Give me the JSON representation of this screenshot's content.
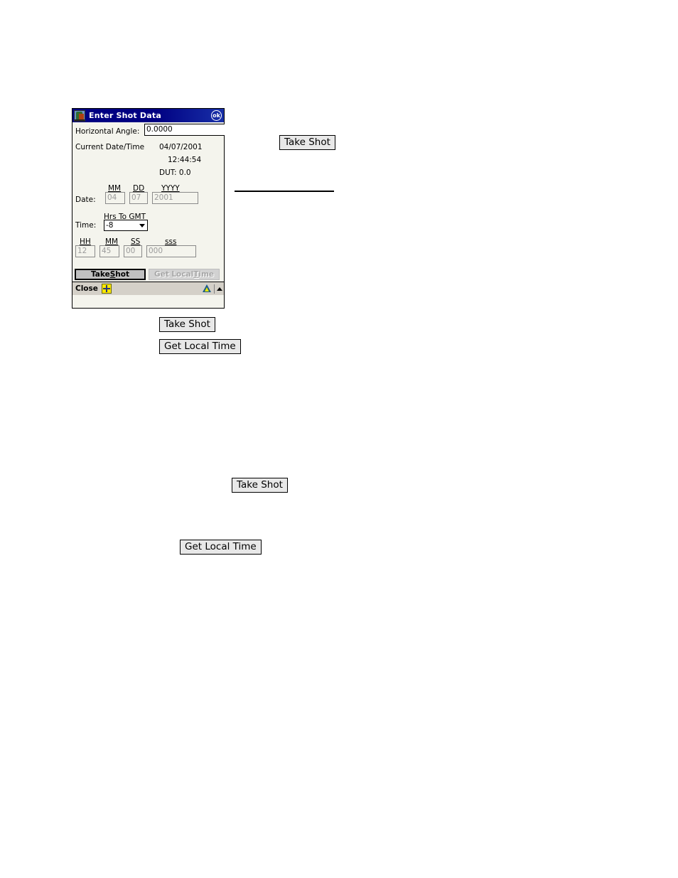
{
  "window": {
    "title": "Enter Shot Data",
    "app_icon": "app-icon",
    "ok_label": "ok"
  },
  "form": {
    "horizontal_angle": {
      "label": "Horizontal Angle:",
      "value": "0.0000"
    },
    "current": {
      "label": "Current Date/Time",
      "date": "04/07/2001",
      "time": "12:44:54",
      "dut": "DUT:   0.0"
    },
    "date_row": {
      "label": "Date:",
      "headers": {
        "mm": "MM",
        "dd": "DD",
        "yyyy": "YYYY"
      },
      "values": {
        "mm": "04",
        "dd": "07",
        "yyyy": "2001"
      }
    },
    "time_row": {
      "label": "Time:",
      "gmt_header": "Hrs To GMT",
      "gmt_value": "-8",
      "gmt_options": [
        "-8"
      ]
    },
    "clock_row": {
      "headers": {
        "hh": "HH",
        "mm": "MM",
        "ss": "SS",
        "sss": "sss"
      },
      "values": {
        "hh": "12",
        "mm": "45",
        "ss": "00",
        "sss": "000"
      }
    }
  },
  "commandbar": {
    "take_shot": "Take Shot",
    "take_shot_pre": "Take ",
    "take_shot_accel": "S",
    "take_shot_post": "hot",
    "get_local_time": "Get Local Time",
    "get_local_pre": "Get Local ",
    "get_local_accel": "T",
    "get_local_post": "ime"
  },
  "taskbar": {
    "close": "Close",
    "sip_icon": "input-panel-icon",
    "tray_icon": "antenna-icon",
    "chevron_icon": "chevron-up-icon"
  },
  "document": {
    "take_shot_1": "Take Shot",
    "take_shot_2": "Take Shot",
    "take_shot_3": "Take Shot",
    "get_local_time_1": "Get Local Time",
    "get_local_time_2": "Get Local Time"
  },
  "colors": {
    "titlebar": "#000080",
    "client_bg": "#f4f4ed",
    "taskbar_bg": "#d4d0c8",
    "button_face": "#c0c0c0",
    "disabled_text": "#a8a8a8",
    "placeholder_text": "#9a9a9a"
  }
}
